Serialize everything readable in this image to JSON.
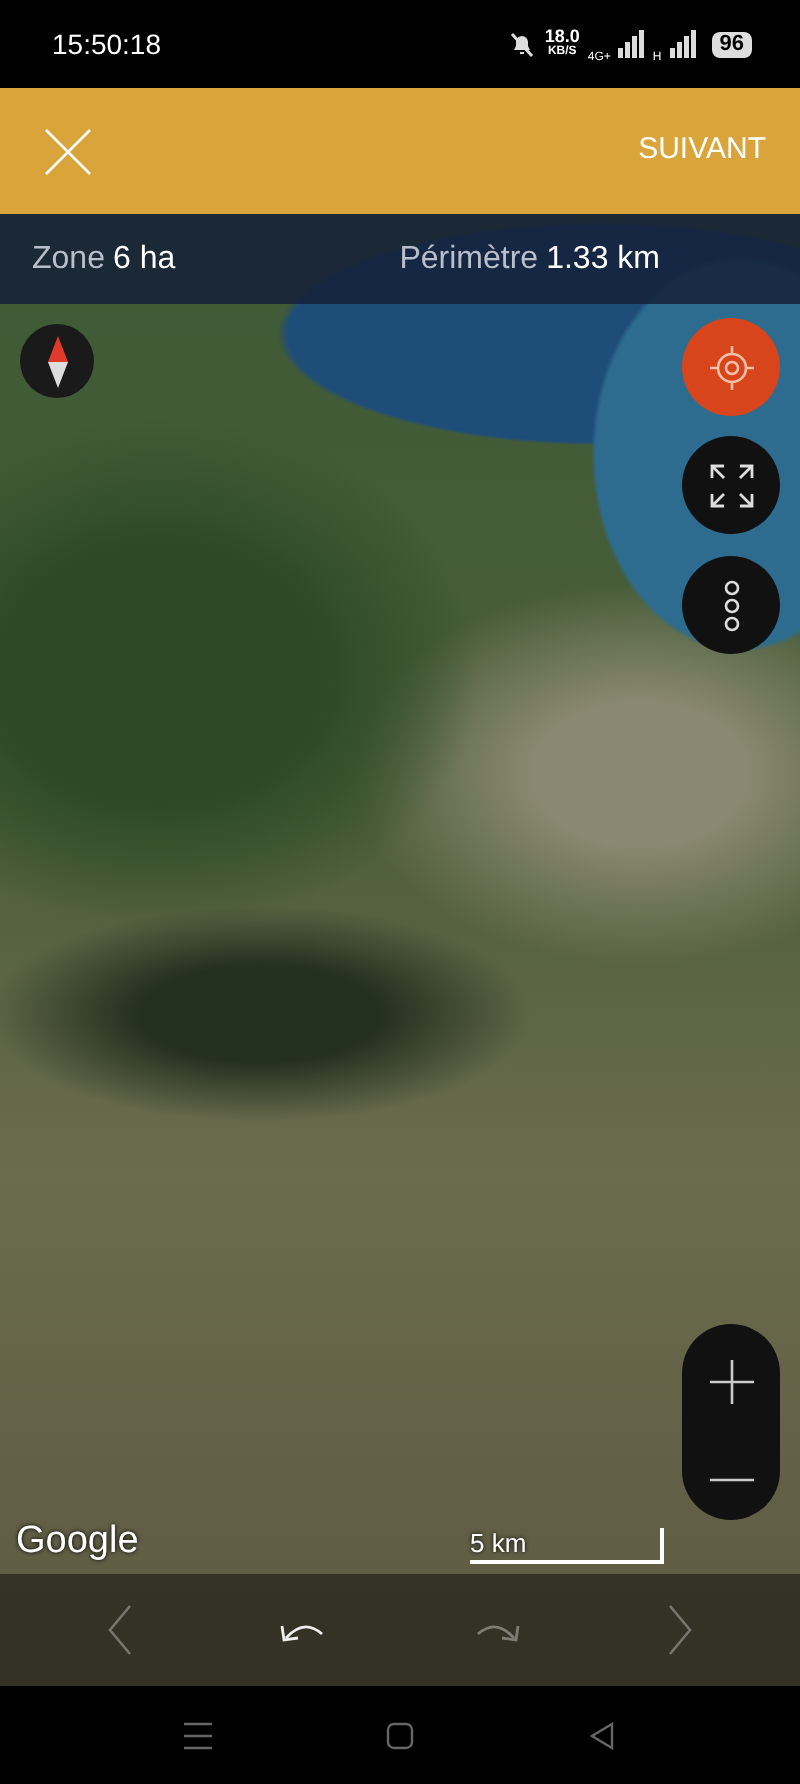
{
  "status_bar": {
    "time": "15:50:18",
    "speed": "18.0",
    "speed_unit": "KB/S",
    "network_1": "4G+",
    "network_2": "H",
    "battery": "96"
  },
  "top_bar": {
    "action": "SUIVANT"
  },
  "stats": [
    {
      "label": "Zone",
      "value": "6 ha"
    },
    {
      "label": "Périmètre",
      "value": "1.33 km"
    }
  ],
  "map": {
    "attribution": "Google",
    "scale": "5 km"
  },
  "toolbar": [
    {
      "kind": "prev",
      "disabled": true
    },
    {
      "kind": "undo",
      "disabled": false
    },
    {
      "kind": "redo",
      "disabled": true
    },
    {
      "kind": "next",
      "disabled": true
    }
  ]
}
